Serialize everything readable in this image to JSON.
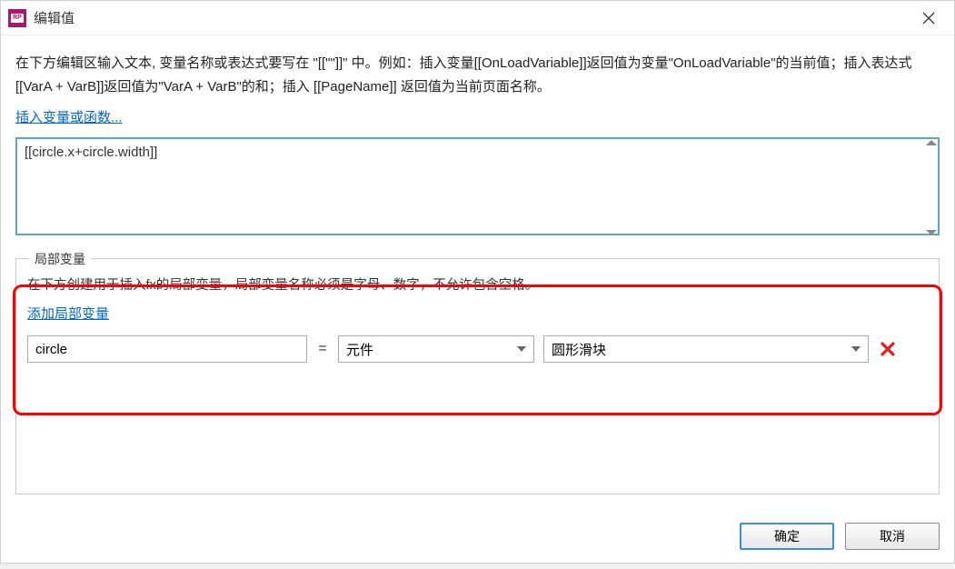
{
  "titlebar": {
    "title": "编辑值",
    "app_icon_label": "RP"
  },
  "instructions": "在下方编辑区输入文本, 变量名称或表达式要写在 \"[[\"\"]]\" 中。例如：插入变量[[OnLoadVariable]]返回值为变量\"OnLoadVariable\"的当前值；插入表达式[[VarA + VarB]]返回值为\"VarA + VarB\"的和；插入 [[PageName]] 返回值为当前页面名称。",
  "insert_link": "插入变量或函数...",
  "expression_value": "[[circle.x+circle.width]]",
  "local_vars": {
    "legend": "局部变量",
    "sub_instructions": "在下方创建用于插入fx的局部变量，局部变量名称必须是字母、数字，不允许包含空格。",
    "add_link": "添加局部变量",
    "row": {
      "name": "circle",
      "equals": "=",
      "type_selected": "元件",
      "target_selected": "圆形滑块"
    }
  },
  "footer": {
    "ok": "确定",
    "cancel": "取消"
  },
  "icons": {
    "close": "close-icon",
    "delete": "delete-icon",
    "chevron": "chevron-down-icon"
  }
}
